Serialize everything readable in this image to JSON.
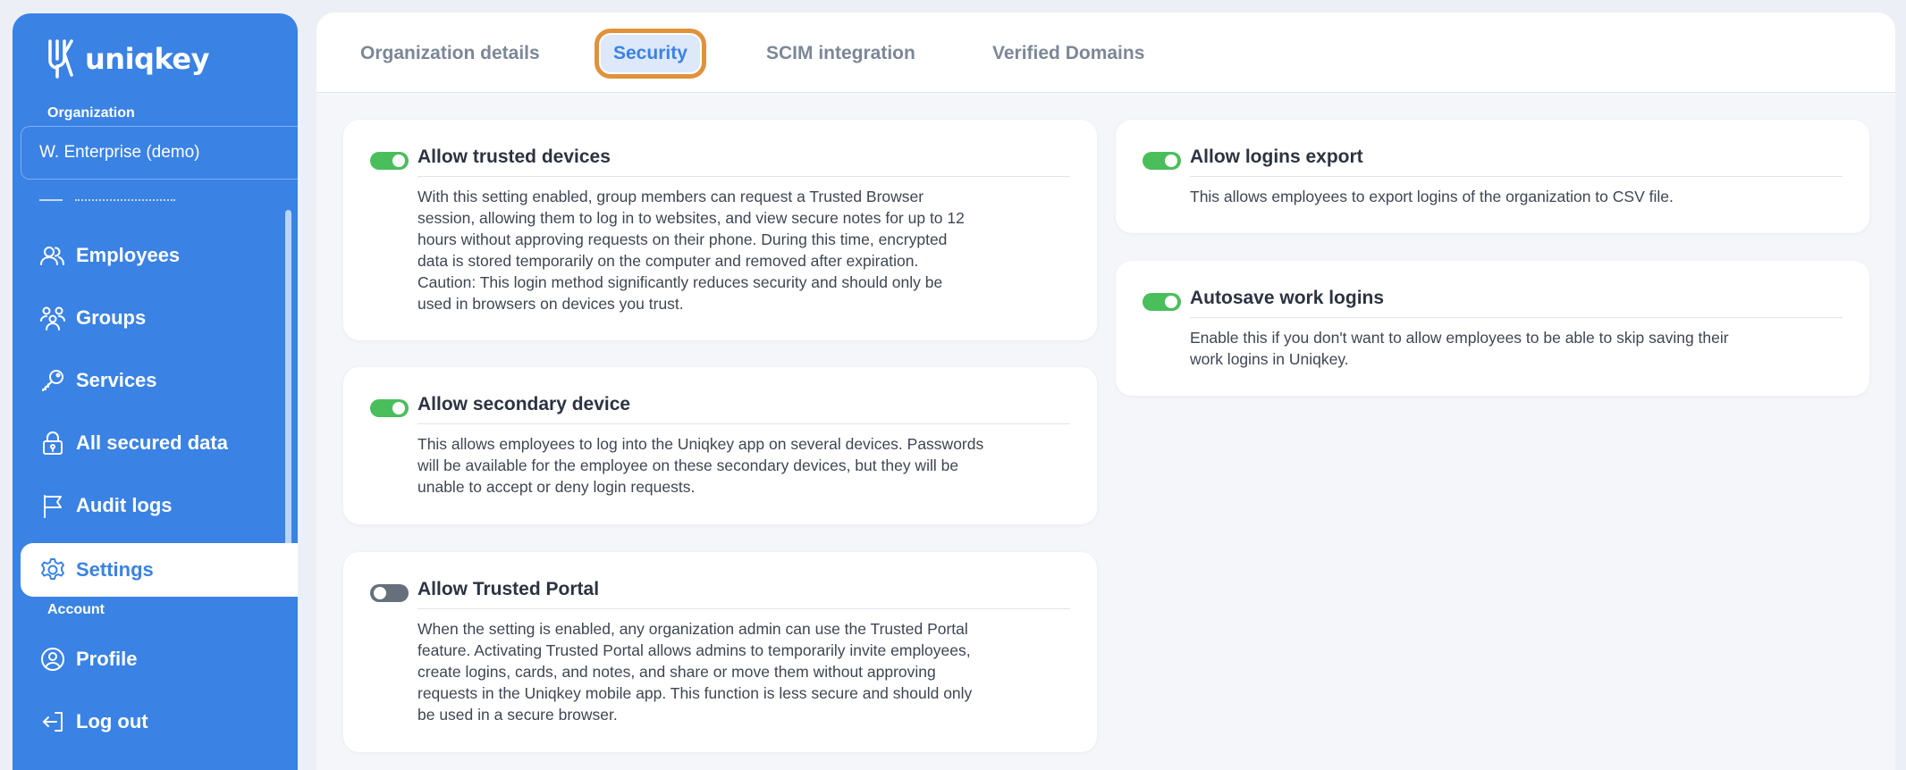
{
  "brand": {
    "name": "uniqkey"
  },
  "sidebar": {
    "org_label": "Organization",
    "org_value": "W. Enterprise (demo)",
    "items": [
      {
        "label": "Employees",
        "icon": "users-icon"
      },
      {
        "label": "Groups",
        "icon": "groups-icon"
      },
      {
        "label": "Services",
        "icon": "key-icon"
      },
      {
        "label": "All secured data",
        "icon": "lock-icon"
      },
      {
        "label": "Audit logs",
        "icon": "flag-icon"
      },
      {
        "label": "Settings",
        "icon": "gear-icon"
      }
    ],
    "account_label": "Account",
    "account_items": [
      {
        "label": "Profile",
        "icon": "profile-icon"
      },
      {
        "label": "Log out",
        "icon": "logout-icon"
      }
    ]
  },
  "tabs": [
    {
      "label": "Organization details",
      "active": false
    },
    {
      "label": "Security",
      "active": true
    },
    {
      "label": "SCIM integration",
      "active": false
    },
    {
      "label": "Verified Domains",
      "active": false
    }
  ],
  "settings": {
    "trusted_devices": {
      "title": "Allow trusted devices",
      "enabled": true,
      "desc": [
        "With this setting enabled, group members can request a Trusted Browser",
        "session, allowing them to log in to websites, and view secure notes for up to 12",
        "hours without approving requests on their phone. During this time, encrypted",
        "data is stored temporarily on the computer and removed after expiration.",
        "Caution: This login method significantly reduces security and should only be",
        "used in browsers on devices you trust."
      ]
    },
    "secondary_device": {
      "title": "Allow secondary device",
      "enabled": true,
      "desc": [
        "This allows employees to log into the Uniqkey app on several devices. Passwords",
        "will be available for the employee on these secondary devices, but they will be",
        "unable to accept or deny login requests."
      ]
    },
    "trusted_portal": {
      "title": "Allow Trusted Portal",
      "enabled": false,
      "desc": [
        "When the setting is enabled, any organization admin can use the Trusted Portal",
        "feature. Activating Trusted Portal allows admins to temporarily invite employees,",
        "create logins, cards, and notes, and share or move them without approving",
        "requests in the Uniqkey mobile app. This function is less secure and should only",
        "be used in a secure browser."
      ]
    },
    "logins_export": {
      "title": "Allow logins export",
      "enabled": true,
      "desc": [
        "This allows employees to export logins of the organization to CSV file."
      ]
    },
    "autosave": {
      "title": "Autosave work logins",
      "enabled": true,
      "desc": [
        "Enable this if you don't want to allow employees to be able to skip saving their",
        "work logins in Uniqkey."
      ]
    }
  },
  "colors": {
    "sidebar": "#3a82e4",
    "toggle_on": "#4bbe5c",
    "toggle_off": "#65707c",
    "active_tab_outline": "#e0923b"
  }
}
